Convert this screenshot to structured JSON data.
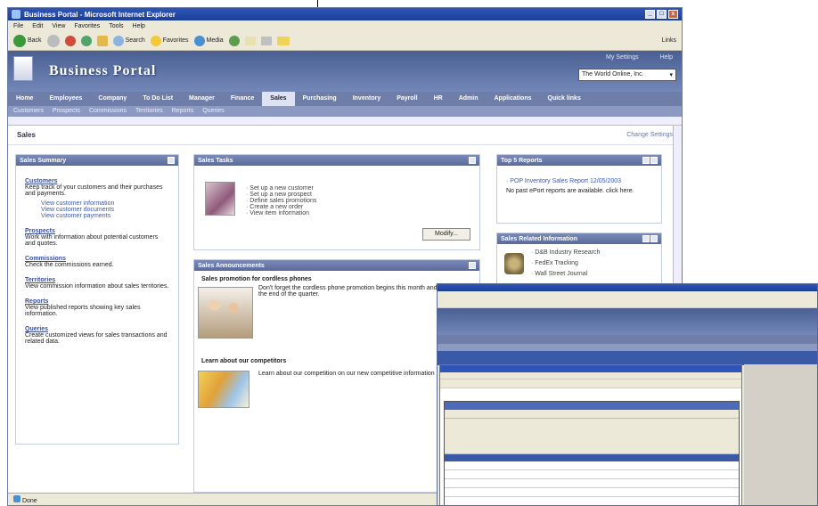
{
  "window": {
    "title": "Business Portal - Microsoft Internet Explorer"
  },
  "menu": [
    "File",
    "Edit",
    "View",
    "Favorites",
    "Tools",
    "Help"
  ],
  "toolbar": {
    "back": "Back",
    "search": "Search",
    "favorites": "Favorites",
    "media": "Media",
    "links": "Links"
  },
  "portal": {
    "title": "Business Portal",
    "header_links": [
      "My Settings",
      "Help"
    ],
    "company": "The World Online, Inc."
  },
  "nav": {
    "items": [
      "Home",
      "Employees",
      "Company",
      "To Do List",
      "Manager",
      "Finance",
      "Sales",
      "Purchasing",
      "Inventory",
      "Payroll",
      "HR",
      "Admin",
      "Applications",
      "Quick links"
    ],
    "active": "Sales"
  },
  "subnav": [
    "Customers",
    "Prospects",
    "Commissions",
    "Territories",
    "Reports",
    "Queries"
  ],
  "page": {
    "title": "Sales",
    "change_settings": "Change Settings"
  },
  "sales_summary": {
    "header": "Sales Summary",
    "sections": [
      {
        "title": "Customers",
        "desc": "Keep track of your customers and their purchases and payments.",
        "links": [
          "View customer information",
          "View customer documents",
          "View customer payments"
        ]
      },
      {
        "title": "Prospects",
        "desc": "Work with information about potential customers and quotes.",
        "links": []
      },
      {
        "title": "Commissions",
        "desc": "Check the commissions earned.",
        "links": []
      },
      {
        "title": "Territories",
        "desc": "View commission information about sales territories.",
        "links": []
      },
      {
        "title": "Reports",
        "desc": "View published reports showing key sales information.",
        "links": []
      },
      {
        "title": "Queries",
        "desc": "Create customized views for sales transactions and related data.",
        "links": []
      }
    ]
  },
  "sales_tasks": {
    "header": "Sales Tasks",
    "items": [
      "Set up a new customer",
      "Set up a new prospect",
      "Define sales promotions",
      "Create a new order",
      "View item information"
    ],
    "modify": "Modify..."
  },
  "sales_announcements": {
    "header": "Sales Announcements",
    "items": [
      {
        "title": "Sales promotion for cordless phones",
        "body": "Don't forget the cordless phone promotion begins this month and runs through the end of the quarter."
      },
      {
        "title": "Learn about our competitors",
        "body": "Learn about our competition on our new competitive information page."
      }
    ]
  },
  "top_reports": {
    "header": "Top 5 Reports",
    "items": [
      "POP Inventory Sales Report 12/05/2003"
    ],
    "note": "No past ePort reports are available. click here."
  },
  "sales_related": {
    "header": "Sales Related Information",
    "items": [
      "D&B Industry Research",
      "FedEx Tracking",
      "Wall Street Journal"
    ]
  },
  "status": "Done"
}
